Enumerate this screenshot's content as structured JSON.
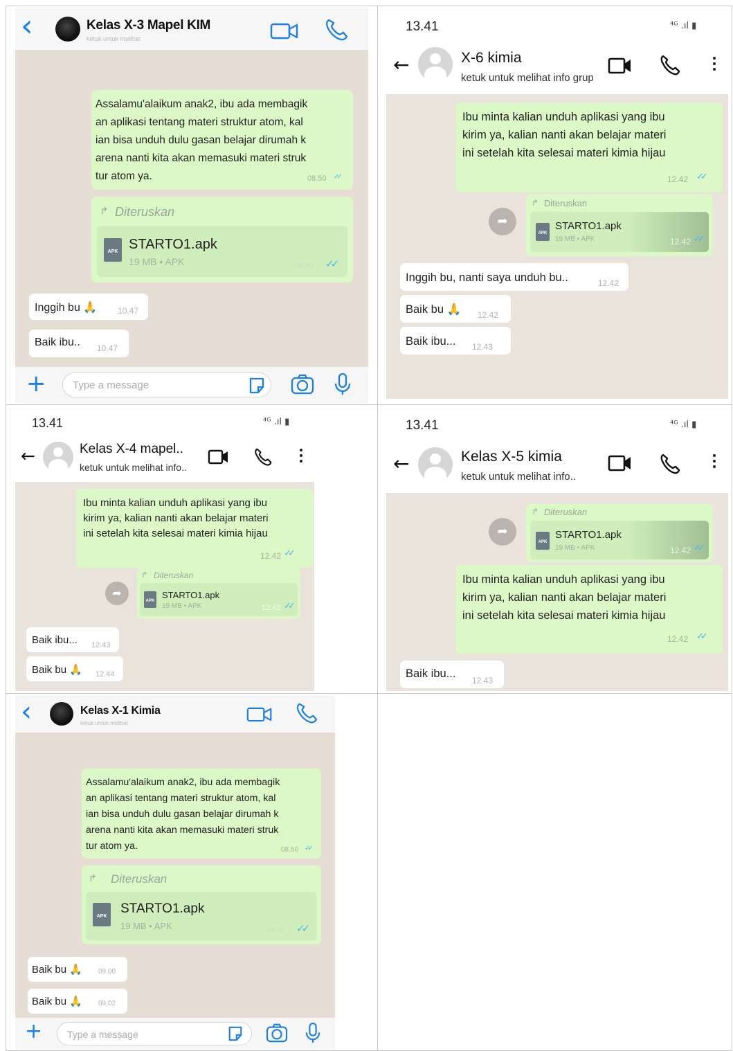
{
  "panel1": {
    "title": "Kelas X-3 Mapel KIM",
    "subtitle": "ketuk untuk melihat",
    "msg1": [
      "Assalamu'alaikum anak2, ibu ada membagik",
      "an aplikasi tentang materi struktur atom, kal",
      "ian bisa unduh dulu gasan belajar dirumah k",
      "arena nanti kita akan memasuki materi struk",
      "tur atom ya."
    ],
    "msg1_time": "08.50",
    "forward_label": "Diteruskan",
    "file_name": "STARTO1.apk",
    "file_meta": "19 MB • APK",
    "file_time": "08.50",
    "reply1": "Inggih bu 🙏",
    "reply1_time": "10.47",
    "reply2": "Baik ibu..",
    "reply2_time": "10.47",
    "input_placeholder": "Type a message"
  },
  "panel2": {
    "clock": "13.41",
    "title": "X-6 kimia",
    "subtitle": "ketuk untuk melihat info grup",
    "msg1": [
      "Ibu minta kalian unduh aplikasi yang ibu",
      "kirim ya, kalian nanti akan belajar materi",
      "ini setelah kita selesai materi kimia hijau"
    ],
    "msg1_time": "12.42",
    "forward_label": "Diteruskan",
    "file_name": "STARTO1.apk",
    "file_meta": "19 MB • APK",
    "file_time": "12.42",
    "reply1": "Inggih bu, nanti saya unduh bu..",
    "reply1_time": "12.42",
    "reply2": "Baik bu 🙏",
    "reply2_time": "12.42",
    "reply3": "Baik ibu...",
    "reply3_time": "12.43"
  },
  "panel3": {
    "clock": "13.41",
    "title": "Kelas X-4 mapel..",
    "subtitle": "ketuk untuk melihat info..",
    "msg1": [
      "Ibu minta kalian unduh aplikasi yang ibu",
      "kirim ya, kalian nanti akan belajar materi",
      "ini setelah kita selesai materi kimia hijau"
    ],
    "msg1_time": "12.42",
    "forward_label": "Diteruskan",
    "file_name": "STARTO1.apk",
    "file_meta": "19 MB • APK",
    "file_time": "12.42",
    "reply1": "Baik ibu...",
    "reply1_time": "12.43",
    "reply2": "Baik bu 🙏",
    "reply2_time": "12.44"
  },
  "panel4": {
    "clock": "13.41",
    "title": "Kelas X-5 kimia",
    "subtitle": "ketuk untuk melihat info..",
    "forward_label": "Diteruskan",
    "file_name": "STARTO1.apk",
    "file_meta": "19 MB • APK",
    "file_time": "12.42",
    "msg1": [
      "Ibu minta kalian unduh aplikasi yang ibu",
      "kirim ya, kalian nanti akan belajar materi",
      "ini setelah kita selesai materi kimia hijau"
    ],
    "msg1_time": "12.42",
    "reply1": "Baik ibu...",
    "reply1_time": "12.43"
  },
  "panel5": {
    "title": "Kelas X-1 Kimia",
    "subtitle": "ketuk untuk melihat",
    "msg1": [
      "Assalamu'alaikum anak2, ibu ada membagik",
      "an aplikasi tentang materi struktur atom, kal",
      "ian bisa unduh dulu gasan belajar dirumah k",
      "arena nanti kita akan memasuki materi struk",
      "tur atom ya."
    ],
    "msg1_time": "08.50",
    "forward_label": "Diteruskan",
    "file_name": "STARTO1.apk",
    "file_meta": "19 MB • APK",
    "file_time": "08.50",
    "reply1": "Baik bu 🙏",
    "reply1_time": "09.00",
    "reply2": "Baik bu 🙏",
    "reply2_time": "09.02",
    "input_placeholder": "Type a message"
  },
  "icons": {
    "back_ios": "‹",
    "back_android": "←",
    "forward_arrow": "↱",
    "share": "➦",
    "tick": "✓✓",
    "status": "⁴ᴳ .ıl ▮",
    "plus": "+"
  },
  "colors": {
    "accent_ios": "#1d7ee8",
    "bubble_out": "#dcf8c6",
    "bubble_in": "#ffffff",
    "chat_bg": "#e6ddd4",
    "read_tick": "#4fb6ec"
  }
}
